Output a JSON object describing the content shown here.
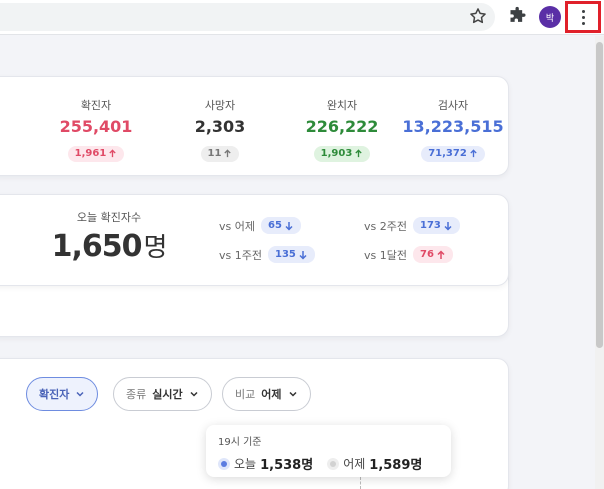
{
  "browser": {
    "star_icon": "star-icon",
    "extensions_icon": "puzzle-icon",
    "avatar_initial": "박",
    "menu_icon": "kebab-menu-icon"
  },
  "stats": [
    {
      "label": "확진자",
      "value": "255,401",
      "delta": "1,961",
      "color": "#e04a66",
      "pill_bg": "#fde7ec"
    },
    {
      "label": "사망자",
      "value": "2,303",
      "delta": "11",
      "color": "#333333",
      "pill_bg": "#eeeeee"
    },
    {
      "label": "완치자",
      "value": "226,222",
      "delta": "1,903",
      "color": "#2e8b3a",
      "pill_bg": "#dff3e0"
    },
    {
      "label": "검사자",
      "value": "13,223,515",
      "delta": "71,372",
      "color": "#4a6fd6",
      "pill_bg": "#e7ecfb"
    }
  ],
  "today": {
    "label": "오늘 확진자수",
    "count": "1,650",
    "unit": "명",
    "comparisons": [
      {
        "label": "vs 어제",
        "value": "65",
        "direction": "down",
        "color": "#4a6fd6",
        "pill_bg": "#e7ecfb"
      },
      {
        "label": "vs 2주전",
        "value": "173",
        "direction": "down",
        "color": "#4a6fd6",
        "pill_bg": "#e7ecfb"
      },
      {
        "label": "vs 1주전",
        "value": "135",
        "direction": "down",
        "color": "#4a6fd6",
        "pill_bg": "#e7ecfb"
      },
      {
        "label": "vs 1달전",
        "value": "76",
        "direction": "up",
        "color": "#e04a66",
        "pill_bg": "#fde7ec"
      }
    ]
  },
  "filters": [
    {
      "prefix": "",
      "value": "확진자"
    },
    {
      "prefix": "종류",
      "value": "실시간"
    },
    {
      "prefix": "비교",
      "value": "어제"
    }
  ],
  "tooltip": {
    "title": "19시 기준",
    "today_label": "오늘",
    "today_value": "1,538명",
    "yesterday_label": "어제",
    "yesterday_value": "1,589명"
  }
}
